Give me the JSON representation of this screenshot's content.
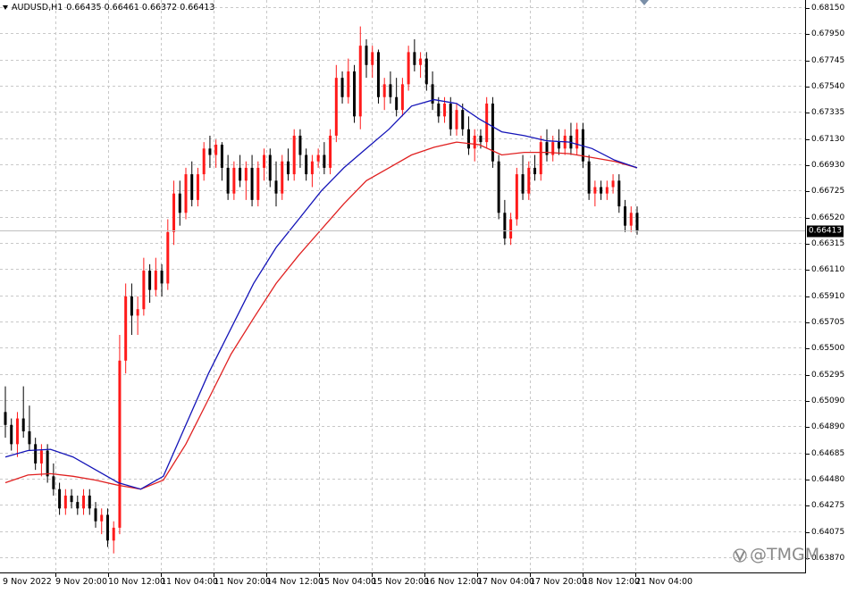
{
  "header": {
    "symbol": "AUDUSD,H1",
    "ohlc": "0.66435 0.66461 0.66372 0.66413"
  },
  "price_axis": {
    "labels": [
      "0.68150",
      "0.67950",
      "0.67745",
      "0.67540",
      "0.67335",
      "0.67130",
      "0.66930",
      "0.66725",
      "0.66520",
      "0.66315",
      "0.66110",
      "0.65910",
      "0.65705",
      "0.65500",
      "0.65295",
      "0.65090",
      "0.64890",
      "0.64685",
      "0.64480",
      "0.64275",
      "0.64075",
      "0.63870"
    ],
    "current_price": "0.66413"
  },
  "time_axis": {
    "labels": [
      "9 Nov 2022",
      "9 Nov 20:00",
      "10 Nov 12:00",
      "11 Nov 04:00",
      "11 Nov 20:00",
      "14 Nov 12:00",
      "15 Nov 04:00",
      "15 Nov 20:00",
      "16 Nov 12:00",
      "17 Nov 04:00",
      "17 Nov 20:00",
      "18 Nov 12:00",
      "21 Nov 04:00"
    ]
  },
  "watermark": {
    "text": "@TMGM",
    "icon": "tmgm-logo-icon"
  },
  "colors": {
    "bull": "#ff1a1a",
    "bear": "#000000",
    "ma_fast": "#1414b8",
    "ma_slow": "#e02020",
    "grid": "#c8c8c8"
  },
  "chart_data": {
    "type": "candlestick",
    "symbol": "AUDUSD",
    "timeframe": "H1",
    "ylim": [
      0.6387,
      0.6815
    ],
    "grid": true,
    "indicators": [
      {
        "type": "moving_average",
        "color": "blue"
      },
      {
        "type": "moving_average",
        "color": "red"
      }
    ],
    "ma_fast": [
      0.6465,
      0.647,
      0.6471,
      0.6465,
      0.6455,
      0.6445,
      0.644,
      0.645,
      0.649,
      0.653,
      0.6565,
      0.66,
      0.6628,
      0.665,
      0.6672,
      0.669,
      0.6705,
      0.672,
      0.6738,
      0.6743,
      0.674,
      0.6728,
      0.6718,
      0.6715,
      0.6711,
      0.671,
      0.6705,
      0.6696,
      0.669
    ],
    "ma_slow": [
      0.6445,
      0.6451,
      0.6452,
      0.645,
      0.6447,
      0.6443,
      0.644,
      0.6447,
      0.6475,
      0.651,
      0.6545,
      0.6573,
      0.66,
      0.6622,
      0.6642,
      0.6662,
      0.668,
      0.669,
      0.67,
      0.6706,
      0.671,
      0.6708,
      0.67,
      0.6702,
      0.6702,
      0.6701,
      0.6698,
      0.6695,
      0.669
    ],
    "ohlc": [
      [
        0.65,
        0.652,
        0.648,
        0.649
      ],
      [
        0.649,
        0.6495,
        0.647,
        0.6475
      ],
      [
        0.6475,
        0.65,
        0.6465,
        0.6495
      ],
      [
        0.6495,
        0.652,
        0.648,
        0.6485
      ],
      [
        0.6485,
        0.6505,
        0.647,
        0.6475
      ],
      [
        0.6475,
        0.648,
        0.6455,
        0.646
      ],
      [
        0.646,
        0.6475,
        0.645,
        0.647
      ],
      [
        0.647,
        0.6475,
        0.6445,
        0.645
      ],
      [
        0.645,
        0.646,
        0.6435,
        0.644
      ],
      [
        0.644,
        0.6445,
        0.642,
        0.6425
      ],
      [
        0.6425,
        0.644,
        0.642,
        0.6435
      ],
      [
        0.6435,
        0.644,
        0.6425,
        0.643
      ],
      [
        0.643,
        0.6435,
        0.642,
        0.6425
      ],
      [
        0.6425,
        0.644,
        0.642,
        0.6435
      ],
      [
        0.6435,
        0.644,
        0.642,
        0.6425
      ],
      [
        0.6425,
        0.643,
        0.641,
        0.6415
      ],
      [
        0.6415,
        0.6425,
        0.6405,
        0.642
      ],
      [
        0.642,
        0.6425,
        0.6395,
        0.64
      ],
      [
        0.64,
        0.6415,
        0.639,
        0.641
      ],
      [
        0.641,
        0.656,
        0.6405,
        0.654
      ],
      [
        0.654,
        0.66,
        0.653,
        0.659
      ],
      [
        0.659,
        0.66,
        0.656,
        0.6575
      ],
      [
        0.6575,
        0.659,
        0.656,
        0.658
      ],
      [
        0.658,
        0.662,
        0.6575,
        0.661
      ],
      [
        0.661,
        0.6615,
        0.6585,
        0.6595
      ],
      [
        0.6595,
        0.662,
        0.659,
        0.661
      ],
      [
        0.661,
        0.6615,
        0.659,
        0.66
      ],
      [
        0.66,
        0.665,
        0.6595,
        0.664
      ],
      [
        0.664,
        0.668,
        0.663,
        0.667
      ],
      [
        0.667,
        0.668,
        0.6645,
        0.6655
      ],
      [
        0.6655,
        0.669,
        0.665,
        0.6685
      ],
      [
        0.6685,
        0.6695,
        0.666,
        0.6665
      ],
      [
        0.6665,
        0.669,
        0.666,
        0.6685
      ],
      [
        0.6685,
        0.671,
        0.668,
        0.6705
      ],
      [
        0.6705,
        0.6715,
        0.669,
        0.67
      ],
      [
        0.67,
        0.6712,
        0.669,
        0.6708
      ],
      [
        0.6708,
        0.671,
        0.668,
        0.669
      ],
      [
        0.669,
        0.67,
        0.6665,
        0.667
      ],
      [
        0.667,
        0.6695,
        0.6665,
        0.669
      ],
      [
        0.669,
        0.67,
        0.6675,
        0.668
      ],
      [
        0.668,
        0.6695,
        0.6665,
        0.669
      ],
      [
        0.669,
        0.67,
        0.666,
        0.6665
      ],
      [
        0.6665,
        0.6695,
        0.666,
        0.669
      ],
      [
        0.669,
        0.6705,
        0.668,
        0.67
      ],
      [
        0.67,
        0.6705,
        0.6675,
        0.668
      ],
      [
        0.668,
        0.6695,
        0.666,
        0.667
      ],
      [
        0.667,
        0.67,
        0.6665,
        0.6695
      ],
      [
        0.6695,
        0.6705,
        0.668,
        0.6685
      ],
      [
        0.6685,
        0.672,
        0.668,
        0.6715
      ],
      [
        0.6715,
        0.672,
        0.669,
        0.67
      ],
      [
        0.67,
        0.6705,
        0.668,
        0.6685
      ],
      [
        0.6685,
        0.67,
        0.6675,
        0.6695
      ],
      [
        0.6695,
        0.6705,
        0.669,
        0.67
      ],
      [
        0.67,
        0.671,
        0.6685,
        0.669
      ],
      [
        0.669,
        0.672,
        0.6685,
        0.6715
      ],
      [
        0.6715,
        0.677,
        0.671,
        0.676
      ],
      [
        0.676,
        0.6765,
        0.674,
        0.6745
      ],
      [
        0.6745,
        0.6775,
        0.674,
        0.6765
      ],
      [
        0.6765,
        0.677,
        0.6725,
        0.673
      ],
      [
        0.673,
        0.68,
        0.672,
        0.6785
      ],
      [
        0.6785,
        0.679,
        0.676,
        0.677
      ],
      [
        0.677,
        0.6785,
        0.676,
        0.678
      ],
      [
        0.678,
        0.6782,
        0.674,
        0.6745
      ],
      [
        0.6745,
        0.676,
        0.6735,
        0.6755
      ],
      [
        0.6755,
        0.6765,
        0.674,
        0.6745
      ],
      [
        0.6745,
        0.676,
        0.673,
        0.6735
      ],
      [
        0.6735,
        0.676,
        0.673,
        0.6755
      ],
      [
        0.6755,
        0.6785,
        0.675,
        0.678
      ],
      [
        0.678,
        0.679,
        0.6765,
        0.677
      ],
      [
        0.677,
        0.678,
        0.676,
        0.6775
      ],
      [
        0.6775,
        0.678,
        0.675,
        0.6755
      ],
      [
        0.6755,
        0.6765,
        0.6735,
        0.674
      ],
      [
        0.674,
        0.6745,
        0.6725,
        0.673
      ],
      [
        0.673,
        0.6745,
        0.6725,
        0.674
      ],
      [
        0.674,
        0.6745,
        0.6715,
        0.672
      ],
      [
        0.672,
        0.674,
        0.6715,
        0.6735
      ],
      [
        0.6735,
        0.674,
        0.6715,
        0.672
      ],
      [
        0.672,
        0.673,
        0.67,
        0.6705
      ],
      [
        0.6705,
        0.672,
        0.6695,
        0.6715
      ],
      [
        0.6715,
        0.672,
        0.6705,
        0.671
      ],
      [
        0.671,
        0.6745,
        0.6705,
        0.674
      ],
      [
        0.674,
        0.6745,
        0.669,
        0.6695
      ],
      [
        0.6695,
        0.67,
        0.665,
        0.6655
      ],
      [
        0.6655,
        0.6665,
        0.663,
        0.6635
      ],
      [
        0.6635,
        0.6655,
        0.663,
        0.665
      ],
      [
        0.665,
        0.669,
        0.6645,
        0.6685
      ],
      [
        0.6685,
        0.67,
        0.6665,
        0.667
      ],
      [
        0.667,
        0.6695,
        0.6665,
        0.669
      ],
      [
        0.669,
        0.67,
        0.668,
        0.6685
      ],
      [
        0.6685,
        0.6715,
        0.668,
        0.671
      ],
      [
        0.671,
        0.672,
        0.6695,
        0.67
      ],
      [
        0.67,
        0.6715,
        0.6695,
        0.671
      ],
      [
        0.671,
        0.672,
        0.67,
        0.6705
      ],
      [
        0.6705,
        0.672,
        0.67,
        0.6715
      ],
      [
        0.6715,
        0.6725,
        0.67,
        0.6705
      ],
      [
        0.6705,
        0.6725,
        0.67,
        0.672
      ],
      [
        0.672,
        0.6725,
        0.669,
        0.6695
      ],
      [
        0.6695,
        0.67,
        0.6665,
        0.667
      ],
      [
        0.667,
        0.668,
        0.666,
        0.6675
      ],
      [
        0.6675,
        0.668,
        0.6665,
        0.667
      ],
      [
        0.667,
        0.668,
        0.6665,
        0.6675
      ],
      [
        0.6675,
        0.6685,
        0.667,
        0.668
      ],
      [
        0.668,
        0.6685,
        0.6655,
        0.666
      ],
      [
        0.666,
        0.6665,
        0.664,
        0.6645
      ],
      [
        0.6645,
        0.666,
        0.664,
        0.6655
      ],
      [
        0.6655,
        0.666,
        0.6638,
        0.6641
      ]
    ]
  }
}
